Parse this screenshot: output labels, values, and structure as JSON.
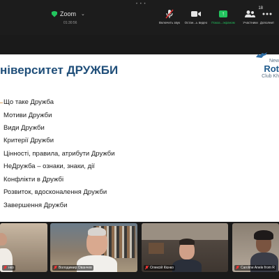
{
  "window": {
    "dots": "• • •"
  },
  "meeting": {
    "app_title": "Zoom",
    "timer": "01:30:56"
  },
  "toolbar": {
    "mute_label": "Включить звук",
    "video_label": "Остан...ь видео",
    "share_label": "Показ...экраном",
    "participants_label": "Участники",
    "participants_count": "18",
    "more_label": "Дополнит"
  },
  "slide": {
    "title": "ніверситет ДРУЖБИ",
    "logo": {
      "line1": "New",
      "line2": "Rot",
      "line3": "Club Kh"
    },
    "items": [
      "Що таке Дружба",
      "Мотиви Дружби",
      "Види Дружби",
      "Критерії Дружби",
      "Цінності, правила, атрибути Дружби",
      "НеДружба – ознаки, знаки, дії",
      "Конфлікти в Дружбі",
      "Розвиток, вдосконалення Дружби",
      "Завершення Дружби"
    ]
  },
  "participants": [
    {
      "name": "нко"
    },
    {
      "name": "Володимир Ованчев"
    },
    {
      "name": "Олексій Кієнко"
    },
    {
      "name": "Caroline Anele from R"
    }
  ],
  "colors": {
    "accent_green": "#22c55e",
    "title_blue": "#1f4e79",
    "bullet_gold": "#d9a05b",
    "mute_red": "#e33333"
  }
}
